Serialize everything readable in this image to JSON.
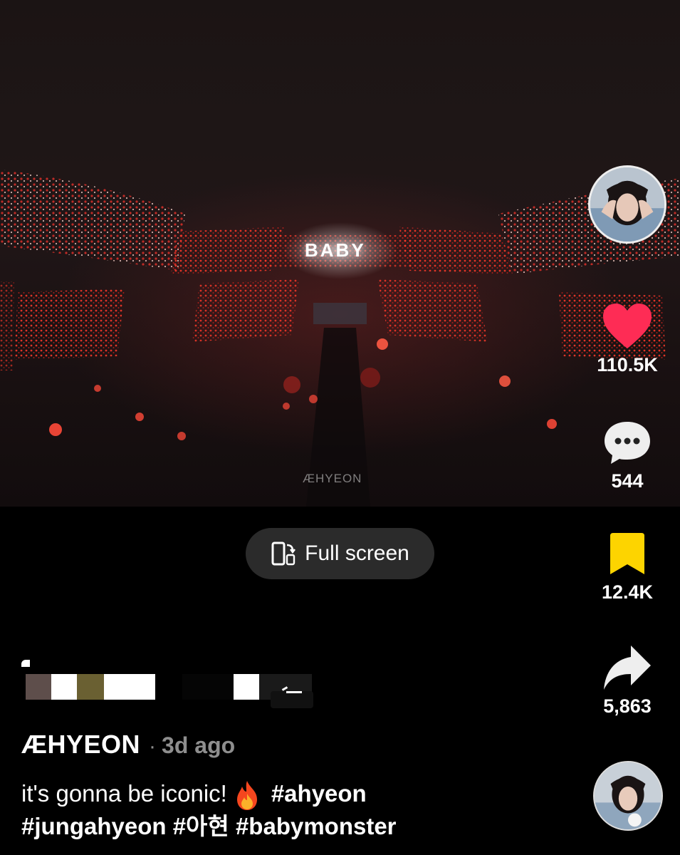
{
  "video": {
    "stage_text": "BABY",
    "watermark": "ÆHYEON"
  },
  "rail": {
    "like_count": "110.5K",
    "comment_count": "544",
    "save_count": "12.4K",
    "share_count": "5,863"
  },
  "fullscreen_label": "Full screen",
  "post": {
    "author": "ÆHYEON",
    "separator": "·",
    "time_ago": "3d ago",
    "caption_text": "it's gonna be iconic!",
    "hashtags": [
      "#ahyeon",
      "#jungahyeon",
      "#아현",
      "#babymonster"
    ]
  },
  "colors": {
    "like": "#fe2c55",
    "save": "#fdd400",
    "pill_bg": "#2b2b2b",
    "muted_text": "#8e8e8e"
  }
}
